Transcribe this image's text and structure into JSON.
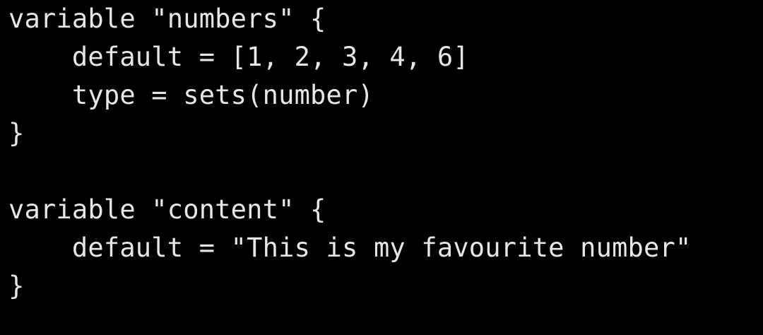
{
  "editor": {
    "background": "#000000",
    "text_color": "#e6e6e6",
    "lines": [
      "variable \"numbers\" {",
      "    default = [1, 2, 3, 4, 6]",
      "    type = sets(number)",
      "}",
      "",
      "variable \"content\" {",
      "    default = \"This is my favourite number\"",
      "}"
    ]
  }
}
